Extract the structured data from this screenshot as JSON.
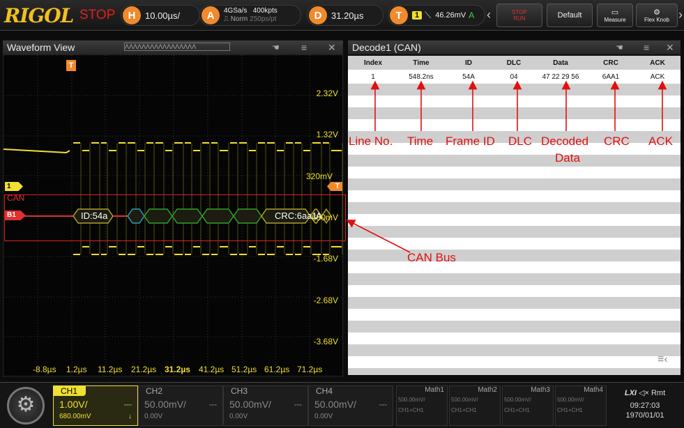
{
  "topbar": {
    "logo": "RIGOL",
    "run_state": "STOP",
    "horizontal": {
      "badge": "H",
      "value": "10.00µs/"
    },
    "acquire": {
      "badge": "A",
      "rate": "4GSa/s",
      "points": "400kpts",
      "mode": "Norm",
      "ps": "250ps/pt"
    },
    "delay": {
      "badge": "D",
      "value": "31.20µs"
    },
    "trigger": {
      "badge": "T",
      "source": "1",
      "level": "46.26mV",
      "mode": "A"
    },
    "stop_run": [
      "STOP",
      "RUN"
    ],
    "default_label": "Default",
    "measure_label": "Measure",
    "flex_knob_label": "Flex Knob"
  },
  "waveform": {
    "title": "Waveform View",
    "volt_labels": [
      "2.32V",
      "1.32V",
      "320mV",
      "-680mV",
      "-1.68V",
      "-2.68V",
      "-3.68V"
    ],
    "time_labels": [
      "-8.8µs",
      "1.2µs",
      "11.2µs",
      "21.2µs",
      "31.2µs",
      "41.2µs",
      "51.2µs",
      "61.2µs",
      "71.2µs"
    ],
    "ch1_marker": "1",
    "trig_marker": "T",
    "bus_label": "CAN",
    "bus_marker": "B1",
    "id_frame": "ID:54a",
    "crc_frame": "CRC:6aa1",
    "ack_frame": "A",
    "colors": {
      "ch1": "#f0e030",
      "trigger": "#f08a2c",
      "bus_box": "#e02020"
    }
  },
  "decode": {
    "title": "Decode1 (CAN)",
    "columns": [
      "Index",
      "Time",
      "ID",
      "DLC",
      "Data",
      "CRC",
      "ACK"
    ],
    "row": [
      "1",
      "548.2ns",
      "54A",
      "04",
      "47 22 29 56",
      "6AA1",
      "ACK"
    ],
    "annotations": {
      "line_no": "Line No.",
      "time": "Time",
      "frame_id": "Frame ID",
      "dlc": "DLC",
      "decoded_1": "Decoded",
      "decoded_2": "Data",
      "crc": "CRC",
      "ack": "ACK",
      "can_bus": "CAN Bus"
    }
  },
  "channels": [
    {
      "name": "CH1",
      "scale": "1.00V/",
      "offset": "680.00mV",
      "active": true
    },
    {
      "name": "CH2",
      "scale": "50.00mV/",
      "offset": "0.00V",
      "active": false
    },
    {
      "name": "CH3",
      "scale": "50.00mV/",
      "offset": "0.00V",
      "active": false
    },
    {
      "name": "CH4",
      "scale": "50.00mV/",
      "offset": "0.00V",
      "active": false
    }
  ],
  "maths": [
    {
      "name": "Math1",
      "scale": "500.00mV/",
      "expr": "CH1+CH1"
    },
    {
      "name": "Math2",
      "scale": "500.00mV/",
      "expr": "CH1+CH1"
    },
    {
      "name": "Math3",
      "scale": "500.00mV/",
      "expr": "CH1+CH1"
    },
    {
      "name": "Math4",
      "scale": "500.00mV/",
      "expr": "CH1+CH1"
    }
  ],
  "status": {
    "lxi": "LXI",
    "rmt": "Rmt",
    "time": "09:27:03",
    "date": "1970/01/01"
  }
}
